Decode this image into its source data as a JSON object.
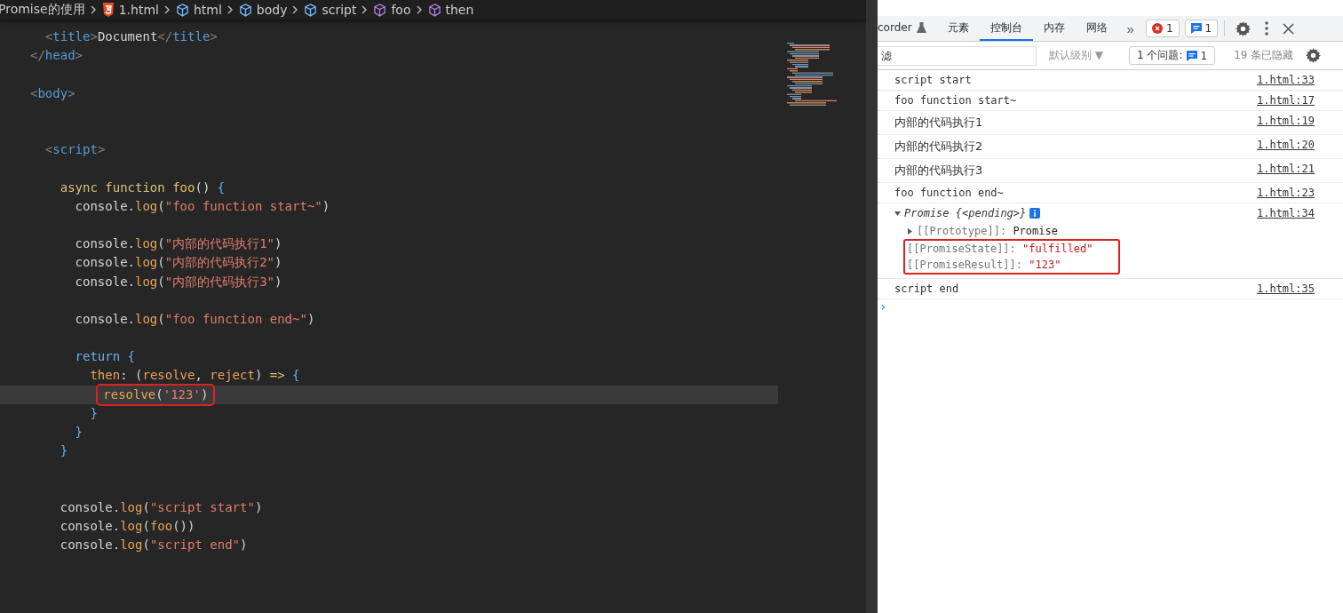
{
  "breadcrumb": [
    {
      "label": "Promise的使用",
      "kind": "folder"
    },
    {
      "label": "1.html",
      "kind": "html5"
    },
    {
      "label": "html",
      "kind": "element"
    },
    {
      "label": "body",
      "kind": "element"
    },
    {
      "label": "script",
      "kind": "element"
    },
    {
      "label": "foo",
      "kind": "symbol"
    },
    {
      "label": "then",
      "kind": "symbol"
    }
  ],
  "editor": {
    "lines": [
      {
        "current": false,
        "boxed": false,
        "tokens": [
          {
            "text": "  <",
            "kind": "bracket"
          },
          {
            "text": "title",
            "kind": "tag"
          },
          {
            "text": ">",
            "kind": "bracket"
          },
          {
            "text": "Document",
            "kind": "plain"
          },
          {
            "text": "</",
            "kind": "bracket"
          },
          {
            "text": "title",
            "kind": "tag"
          },
          {
            "text": ">",
            "kind": "bracket"
          }
        ]
      },
      {
        "current": false,
        "boxed": false,
        "tokens": [
          {
            "text": "</",
            "kind": "bracket"
          },
          {
            "text": "head",
            "kind": "tag"
          },
          {
            "text": ">",
            "kind": "bracket"
          }
        ]
      },
      {
        "current": false,
        "boxed": false
      },
      {
        "current": false,
        "boxed": false,
        "tokens": [
          {
            "text": "<",
            "kind": "bracket"
          },
          {
            "text": "body",
            "kind": "tag"
          },
          {
            "text": ">",
            "kind": "bracket"
          }
        ]
      },
      {
        "current": false,
        "boxed": false
      },
      {
        "current": false,
        "boxed": false
      },
      {
        "current": false,
        "boxed": false,
        "tokens": [
          {
            "text": "  <",
            "kind": "bracket"
          },
          {
            "text": "script",
            "kind": "tag"
          },
          {
            "text": ">",
            "kind": "bracket"
          }
        ]
      },
      {
        "current": false,
        "boxed": false
      },
      {
        "current": false,
        "boxed": false,
        "tokens": [
          {
            "text": "    async function ",
            "kind": "keyword"
          },
          {
            "text": "foo",
            "kind": "func"
          },
          {
            "text": "() ",
            "kind": "punct"
          },
          {
            "text": "{",
            "kind": "brace"
          }
        ]
      },
      {
        "current": false,
        "boxed": false,
        "tokens": [
          {
            "text": "      console.",
            "kind": "plain"
          },
          {
            "text": "log",
            "kind": "method"
          },
          {
            "text": "(",
            "kind": "punct"
          },
          {
            "text": "\"foo function start~\"",
            "kind": "string"
          },
          {
            "text": ")",
            "kind": "punct"
          }
        ]
      },
      {
        "current": false,
        "boxed": false
      },
      {
        "current": false,
        "boxed": false,
        "tokens": [
          {
            "text": "      console.",
            "kind": "plain"
          },
          {
            "text": "log",
            "kind": "method"
          },
          {
            "text": "(",
            "kind": "punct"
          },
          {
            "text": "\"内部的代码执行1\"",
            "kind": "string"
          },
          {
            "text": ")",
            "kind": "punct"
          }
        ]
      },
      {
        "current": false,
        "boxed": false,
        "tokens": [
          {
            "text": "      console.",
            "kind": "plain"
          },
          {
            "text": "log",
            "kind": "method"
          },
          {
            "text": "(",
            "kind": "punct"
          },
          {
            "text": "\"内部的代码执行2\"",
            "kind": "string"
          },
          {
            "text": ")",
            "kind": "punct"
          }
        ]
      },
      {
        "current": false,
        "boxed": false,
        "tokens": [
          {
            "text": "      console.",
            "kind": "plain"
          },
          {
            "text": "log",
            "kind": "method"
          },
          {
            "text": "(",
            "kind": "punct"
          },
          {
            "text": "\"内部的代码执行3\"",
            "kind": "string"
          },
          {
            "text": ")",
            "kind": "punct"
          }
        ]
      },
      {
        "current": false,
        "boxed": false
      },
      {
        "current": false,
        "boxed": false,
        "tokens": [
          {
            "text": "      console.",
            "kind": "plain"
          },
          {
            "text": "log",
            "kind": "method"
          },
          {
            "text": "(",
            "kind": "punct"
          },
          {
            "text": "\"foo function end~\"",
            "kind": "string"
          },
          {
            "text": ")",
            "kind": "punct"
          }
        ]
      },
      {
        "current": false,
        "boxed": false
      },
      {
        "current": false,
        "boxed": false,
        "tokens": [
          {
            "text": "      return ",
            "kind": "control"
          },
          {
            "text": "{",
            "kind": "brace"
          }
        ]
      },
      {
        "current": false,
        "boxed": false,
        "tokens": [
          {
            "text": "        then",
            "kind": "method"
          },
          {
            "text": ": (",
            "kind": "punct"
          },
          {
            "text": "resolve",
            "kind": "method"
          },
          {
            "text": ", ",
            "kind": "punct"
          },
          {
            "text": "reject",
            "kind": "method"
          },
          {
            "text": ") ",
            "kind": "punct"
          },
          {
            "text": "=>",
            "kind": "keyword"
          },
          {
            "text": " {",
            "kind": "brace"
          }
        ]
      },
      {
        "current": true,
        "boxed": true,
        "tokens": [
          {
            "text": "          resolve",
            "kind": "method"
          },
          {
            "text": "(",
            "kind": "punct"
          },
          {
            "text": "'123'",
            "kind": "string"
          },
          {
            "text": ")",
            "kind": "punct"
          }
        ]
      },
      {
        "current": false,
        "boxed": false,
        "tokens": [
          {
            "text": "        }",
            "kind": "brace"
          }
        ]
      },
      {
        "current": false,
        "boxed": false,
        "tokens": [
          {
            "text": "      }",
            "kind": "brace"
          }
        ]
      },
      {
        "current": false,
        "boxed": false,
        "tokens": [
          {
            "text": "    }",
            "kind": "brace"
          }
        ]
      },
      {
        "current": false,
        "boxed": false
      },
      {
        "current": false,
        "boxed": false
      },
      {
        "current": false,
        "boxed": false,
        "tokens": [
          {
            "text": "    console.",
            "kind": "plain"
          },
          {
            "text": "log",
            "kind": "method"
          },
          {
            "text": "(",
            "kind": "punct"
          },
          {
            "text": "\"script start\"",
            "kind": "string"
          },
          {
            "text": ")",
            "kind": "punct"
          }
        ]
      },
      {
        "current": false,
        "boxed": false,
        "tokens": [
          {
            "text": "    console.",
            "kind": "plain"
          },
          {
            "text": "log",
            "kind": "method"
          },
          {
            "text": "(",
            "kind": "punct"
          },
          {
            "text": "foo",
            "kind": "method"
          },
          {
            "text": "())",
            "kind": "punct"
          }
        ]
      },
      {
        "current": false,
        "boxed": false,
        "tokens": [
          {
            "text": "    console.",
            "kind": "plain"
          },
          {
            "text": "log",
            "kind": "method"
          },
          {
            "text": "(",
            "kind": "punct"
          },
          {
            "text": "\"script end\"",
            "kind": "string"
          },
          {
            "text": ")",
            "kind": "punct"
          }
        ]
      }
    ]
  },
  "devtools": {
    "tabs": [
      {
        "label": "corder",
        "kind": "flask",
        "selected": false
      },
      {
        "label": "元素",
        "kind": "plain",
        "selected": false
      },
      {
        "label": "控制台",
        "kind": "plain",
        "selected": true
      },
      {
        "label": "内存",
        "kind": "plain",
        "selected": false
      },
      {
        "label": "网络",
        "kind": "plain",
        "selected": false
      }
    ],
    "more": "»",
    "error_count": "1",
    "message_count": "1",
    "filter": {
      "placeholder": "滤"
    },
    "level_select": "默认级别 ▼",
    "issues_label": "1 个问题:",
    "issues_count": "1",
    "hidden_count": "19 条已隐藏",
    "messages": [
      {
        "kind": "log",
        "text": "script start",
        "source": "1.html:33"
      },
      {
        "kind": "log",
        "text": "foo function start~",
        "source": "1.html:17"
      },
      {
        "kind": "log",
        "text": "内部的代码执行1",
        "source": "1.html:19"
      },
      {
        "kind": "log",
        "text": "内部的代码执行2",
        "source": "1.html:20"
      },
      {
        "kind": "log",
        "text": "内部的代码执行3",
        "source": "1.html:21"
      },
      {
        "kind": "log",
        "text": "foo function end~",
        "source": "1.html:23"
      },
      {
        "kind": "object",
        "type_name": "Promise",
        "summary": "{<pending>}",
        "expanded": true,
        "source": "1.html:34",
        "children": [
          {
            "kind": "prototype",
            "key": "[[Prototype]]:",
            "value": "Promise",
            "boxed": false
          },
          {
            "kind": "property",
            "key": "[[PromiseState]]:",
            "value": "\"fulfilled\"",
            "boxed": true
          },
          {
            "kind": "property",
            "key": "[[PromiseResult]]:",
            "value": "\"123\"",
            "boxed": true
          }
        ]
      },
      {
        "kind": "log",
        "text": "script end",
        "source": "1.html:35"
      }
    ],
    "prompt": "›"
  }
}
